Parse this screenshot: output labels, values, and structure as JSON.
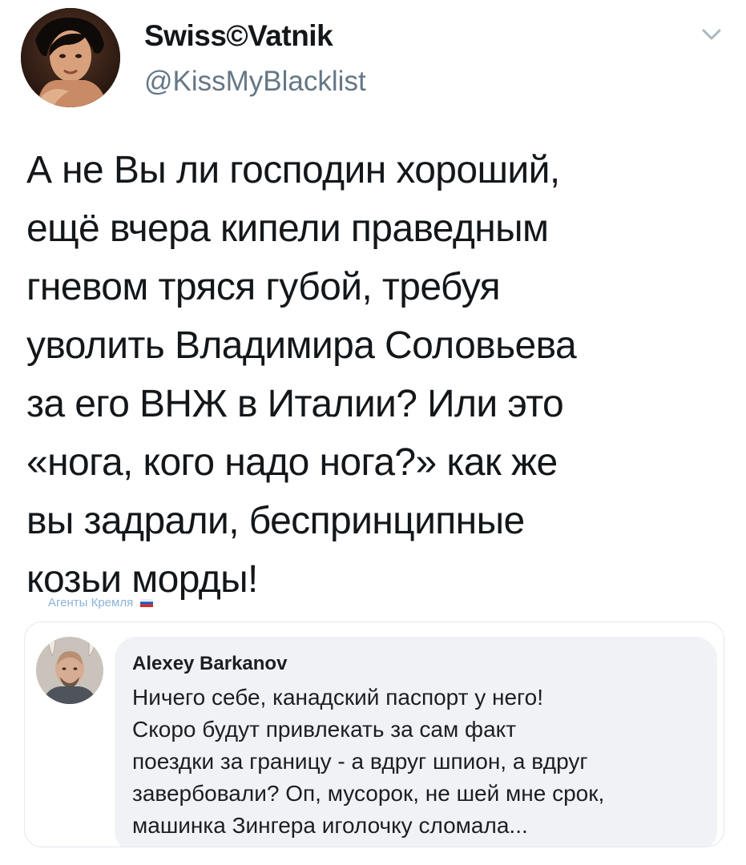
{
  "tweet": {
    "display_name": "Swiss©Vatnik",
    "handle": "@KissMyBlacklist",
    "text_lines": [
      "А не Вы ли господин хороший,",
      "ещё вчера кипели праведным",
      "гневом тряся губой, требуя",
      "уволить Владимира Соловьева",
      "за его ВНЖ в Италии? Или это",
      "«нога, кого надо нога?» как же",
      "вы задрали, беспринципные",
      "козьи морды!"
    ]
  },
  "icons": {
    "menu": "chevron-down-icon",
    "flag": "russian-flag-icon"
  },
  "image_caption": "Агенты Кремля",
  "embedded_comment": {
    "author": "Alexey Barkanov",
    "text_lines": [
      "Ничего себе, канадский паспорт у него!",
      "Скоро будут привлекать за сам факт",
      "поездки за границу - а вдруг шпион, а вдруг",
      "завербовали? Оп, мусорок, не шей мне срок,",
      "машинка Зингера иголочку сломала..."
    ]
  },
  "colors": {
    "text": "#14171a",
    "secondary": "#657786",
    "caption": "#8ab4d8",
    "bubble": "#f0f2f5",
    "border": "#e1e8ed"
  }
}
